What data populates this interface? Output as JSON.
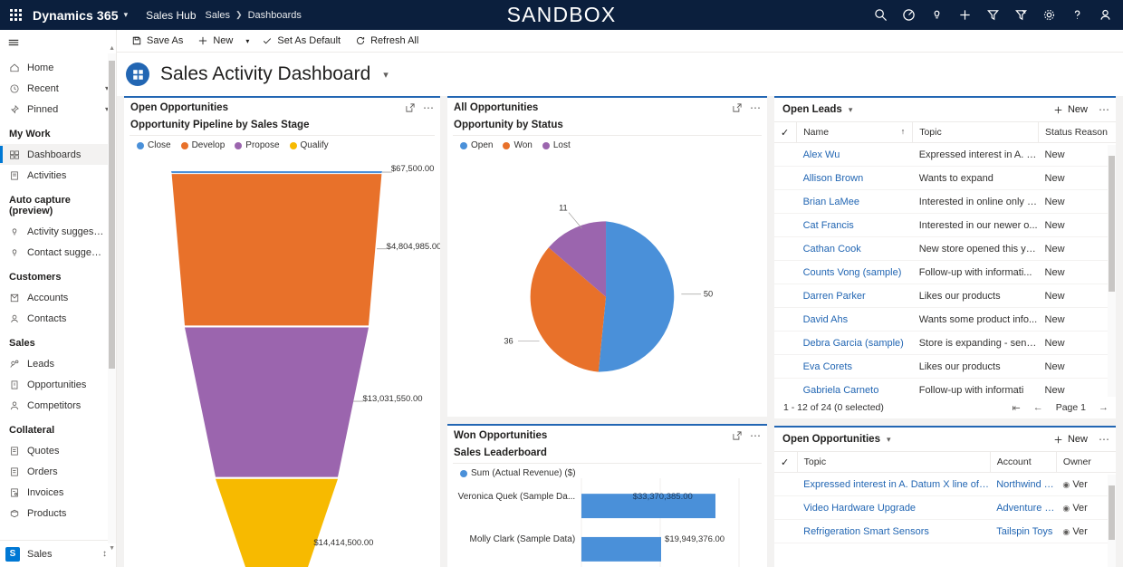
{
  "topnav": {
    "waffle": "app-launcher",
    "brand": "Dynamics 365",
    "app": "Sales Hub",
    "breadcrumb_area": "Sales",
    "breadcrumb_page": "Dashboards",
    "sandbox_banner": "SANDBOX",
    "icons": [
      "search-icon",
      "assistant-icon",
      "insights-icon",
      "add-icon",
      "filter-icon",
      "relationship-assistant-icon",
      "settings-icon",
      "help-icon",
      "user-icon"
    ]
  },
  "sidebar": {
    "hamburger": "site-map-toggle",
    "items": [
      {
        "label": "Home",
        "icon": "home-icon",
        "caret": false
      },
      {
        "label": "Recent",
        "icon": "clock-icon",
        "caret": true
      },
      {
        "label": "Pinned",
        "icon": "pin-icon",
        "caret": true
      }
    ],
    "groups": [
      {
        "title": "My Work",
        "items": [
          {
            "label": "Dashboards",
            "icon": "dashboard-icon",
            "selected": true
          },
          {
            "label": "Activities",
            "icon": "activities-icon",
            "selected": false
          }
        ]
      },
      {
        "title": "Auto capture (preview)",
        "items": [
          {
            "label": "Activity suggestions",
            "icon": "lightbulb-icon",
            "selected": false
          },
          {
            "label": "Contact suggestio...",
            "icon": "lightbulb-icon",
            "selected": false
          }
        ]
      },
      {
        "title": "Customers",
        "items": [
          {
            "label": "Accounts",
            "icon": "accounts-icon",
            "selected": false
          },
          {
            "label": "Contacts",
            "icon": "contact-icon",
            "selected": false
          }
        ]
      },
      {
        "title": "Sales",
        "items": [
          {
            "label": "Leads",
            "icon": "leads-icon",
            "selected": false
          },
          {
            "label": "Opportunities",
            "icon": "opportunity-icon",
            "selected": false
          },
          {
            "label": "Competitors",
            "icon": "competitors-icon",
            "selected": false
          }
        ]
      },
      {
        "title": "Collateral",
        "items": [
          {
            "label": "Quotes",
            "icon": "quote-icon",
            "selected": false
          },
          {
            "label": "Orders",
            "icon": "order-icon",
            "selected": false
          },
          {
            "label": "Invoices",
            "icon": "invoice-icon",
            "selected": false
          },
          {
            "label": "Products",
            "icon": "product-icon",
            "selected": false
          }
        ]
      }
    ],
    "footer": {
      "badge": "S",
      "label": "Sales",
      "switcher": "app-switcher-icon"
    }
  },
  "commandbar": {
    "save_as": "Save As",
    "new": "New",
    "set_as_default": "Set As Default",
    "refresh_all": "Refresh All"
  },
  "page": {
    "title": "Sales Activity Dashboard",
    "title_caret": "chevron-down-icon",
    "icon": "dashboard-tile-icon"
  },
  "tiles": {
    "open_opportunities_funnel": {
      "title": "Open Opportunities",
      "chart_title": "Opportunity Pipeline by Sales Stage",
      "expand": "expand-icon",
      "more": "more-options"
    },
    "all_opportunities_pie": {
      "title": "All Opportunities",
      "chart_title": "Opportunity by Status",
      "expand": "expand-icon",
      "more": "more-options"
    },
    "won_opportunities_bar": {
      "title": "Won Opportunities",
      "chart_title": "Sales Leaderboard",
      "expand": "expand-icon",
      "more": "more-options"
    },
    "open_leads": {
      "title": "Open Leads",
      "new_label": "New",
      "columns": [
        "Name",
        "Topic",
        "Status Reason"
      ],
      "rows": [
        {
          "name": "Alex Wu",
          "topic": "Expressed interest in A. D...",
          "status": "New"
        },
        {
          "name": "Allison Brown",
          "topic": "Wants to expand",
          "status": "New"
        },
        {
          "name": "Brian LaMee",
          "topic": "Interested in online only s...",
          "status": "New"
        },
        {
          "name": "Cat Francis",
          "topic": "Interested in our newer o...",
          "status": "New"
        },
        {
          "name": "Cathan Cook",
          "topic": "New store opened this ye...",
          "status": "New"
        },
        {
          "name": "Counts Vong (sample)",
          "topic": "Follow-up with informati...",
          "status": "New"
        },
        {
          "name": "Darren Parker",
          "topic": "Likes our products",
          "status": "New"
        },
        {
          "name": "David Ahs",
          "topic": "Wants some product info...",
          "status": "New"
        },
        {
          "name": "Debra Garcia (sample)",
          "topic": "Store is expanding - send...",
          "status": "New"
        },
        {
          "name": "Eva Corets",
          "topic": "Likes our products",
          "status": "New"
        },
        {
          "name": "Gabriela Carneto",
          "topic": "Follow-up with informati",
          "status": "New"
        }
      ],
      "pager_text": "1 - 12 of 24 (0 selected)",
      "page_label": "Page 1"
    },
    "open_opportunities_grid": {
      "title": "Open Opportunities",
      "new_label": "New",
      "columns": [
        "Topic",
        "Account",
        "Owner"
      ],
      "rows": [
        {
          "topic": "Expressed interest in A. Datum X line of printers",
          "account": "Northwind Trac",
          "owner": "Ver"
        },
        {
          "topic": "Video Hardware Upgrade",
          "account": "Adventure Wor",
          "owner": "Ver"
        },
        {
          "topic": "Refrigeration Smart Sensors",
          "account": "Tailspin Toys",
          "owner": "Ver"
        }
      ]
    }
  },
  "chart_data": [
    {
      "type": "funnel",
      "title": "Opportunity Pipeline by Sales Stage",
      "legend": [
        {
          "name": "Close",
          "color": "#4a90d9"
        },
        {
          "name": "Develop",
          "color": "#e8712a"
        },
        {
          "name": "Propose",
          "color": "#9b65ae"
        },
        {
          "name": "Qualify",
          "color": "#f7ba00"
        }
      ],
      "categories": [
        "Close",
        "Develop",
        "Propose",
        "Qualify"
      ],
      "values": [
        67500.0,
        4804985.0,
        13031550.0,
        14414500.0
      ],
      "labels": [
        "$67,500.00",
        "$4,804,985.00",
        "$13,031,550.00",
        "$14,414,500.00"
      ],
      "ylabel": "",
      "xlabel": ""
    },
    {
      "type": "pie",
      "title": "Opportunity by Status",
      "legend": [
        {
          "name": "Open",
          "color": "#4a90d9"
        },
        {
          "name": "Won",
          "color": "#e8712a"
        },
        {
          "name": "Lost",
          "color": "#9b65ae"
        }
      ],
      "categories": [
        "Open",
        "Won",
        "Lost"
      ],
      "values": [
        50,
        36,
        11
      ],
      "labels": [
        "50",
        "36",
        "11"
      ]
    },
    {
      "type": "bar",
      "title": "Sales Leaderboard",
      "legend": [
        {
          "name": "Sum (Actual Revenue) ($)",
          "color": "#4a90d9"
        }
      ],
      "orientation": "horizontal",
      "categories": [
        "Veronica Quek (Sample Da...",
        "Molly Clark (Sample Data)"
      ],
      "values": [
        33370385.0,
        19949376.0
      ],
      "labels": [
        "$33,370,385.00",
        "$19,949,376.00"
      ],
      "xlabel": "",
      "ylabel": ""
    }
  ]
}
